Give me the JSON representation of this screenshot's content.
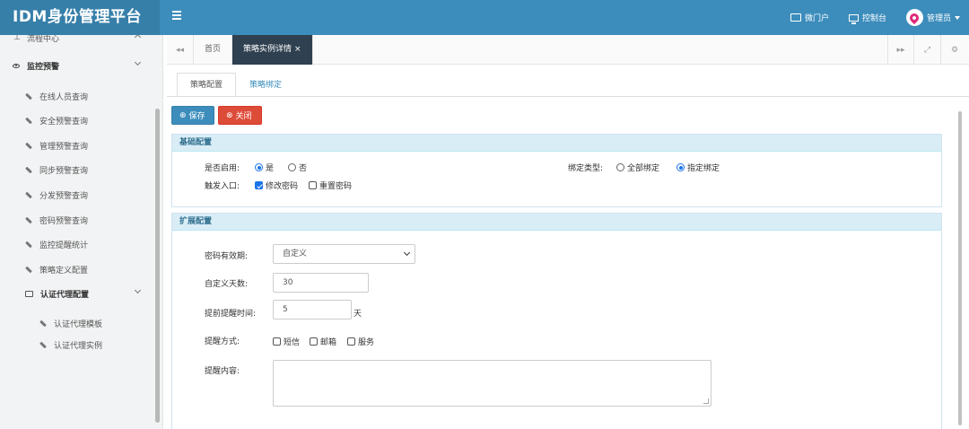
{
  "app": {
    "title": "IDM身份管理平台"
  },
  "topnav": {
    "portal": "微门户",
    "console": "控制台",
    "user": "管理员"
  },
  "sidebar": {
    "partial_item": "流程中心",
    "group": "监控预警",
    "items": [
      {
        "label": "在线人员查询"
      },
      {
        "label": "安全预警查询"
      },
      {
        "label": "管理预警查询"
      },
      {
        "label": "同步预警查询"
      },
      {
        "label": "分发预警查询"
      },
      {
        "label": "密码预警查询"
      },
      {
        "label": "监控提醒统计"
      },
      {
        "label": "策略定义配置"
      }
    ],
    "subgroup": "认证代理配置",
    "subitems": [
      {
        "label": "认证代理模板"
      },
      {
        "label": "认证代理实例"
      }
    ]
  },
  "tabs": {
    "home": "首页",
    "active": "策略实例详情",
    "close_glyph": "×"
  },
  "subtabs": [
    "策略配置",
    "策略绑定"
  ],
  "buttons": {
    "save": "保存",
    "close": "关闭"
  },
  "basic": {
    "title": "基础配置",
    "enable_label": "是否启用:",
    "enable_yes": "是",
    "enable_no": "否",
    "enable_value": "是",
    "bind_type_label": "绑定类型:",
    "bind_all": "全部绑定",
    "bind_specified": "指定绑定",
    "bind_value": "指定绑定",
    "trigger_label": "触发入口:",
    "trigger_change": "修改密码",
    "trigger_reset": "重置密码",
    "trigger_change_checked": true,
    "trigger_reset_checked": false
  },
  "extended": {
    "title": "扩展配置",
    "validity_label": "密码有效期:",
    "validity_value": "自定义",
    "custom_days_label": "自定义天数:",
    "custom_days_value": "30",
    "advance_label": "提前提醒时间:",
    "advance_value": "5",
    "advance_unit": "天",
    "method_label": "提醒方式:",
    "methods": [
      "短信",
      "邮箱",
      "服务"
    ],
    "content_label": "提醒内容:",
    "content_value": ""
  },
  "colors": {
    "header": "#3c8dbc",
    "brand": "#367fa9",
    "active_tab": "#2f4050",
    "save": "#3c8dbc",
    "close": "#dd4b39",
    "panel_head": "#d9edf7"
  }
}
